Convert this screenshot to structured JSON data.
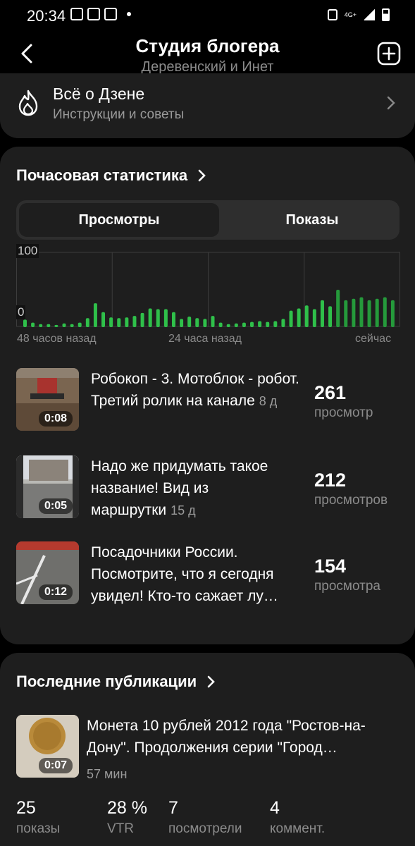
{
  "status_bar": {
    "time": "20:34",
    "network": "4G+"
  },
  "header": {
    "title": "Студия блогера",
    "subtitle": "Деревенский и Инет"
  },
  "zen_card": {
    "title": "Всё о Дзене",
    "subtitle": "Инструкции и советы"
  },
  "hourly_stats": {
    "title": "Почасовая статистика",
    "tabs": [
      {
        "label": "Просмотры",
        "active": true
      },
      {
        "label": "Показы",
        "active": false
      }
    ],
    "x_labels": [
      "48 часов назад",
      "24 часа назад",
      "сейчас"
    ]
  },
  "chart_data": {
    "type": "bar",
    "ylim": [
      0,
      100
    ],
    "y_tick_labels": [
      "100",
      "0"
    ],
    "xlabels": [
      "48 часов назад",
      "24 часа назад",
      "сейчас"
    ],
    "grid": true,
    "colors": {
      "bar": "#2fc04a",
      "bar_recent": "#259a3b"
    },
    "values": [
      10,
      6,
      4,
      4,
      3,
      5,
      4,
      6,
      12,
      32,
      20,
      13,
      12,
      13,
      15,
      19,
      25,
      24,
      24,
      20,
      11,
      14,
      12,
      11,
      15,
      6,
      4,
      5,
      6,
      7,
      8,
      7,
      8,
      11,
      22,
      25,
      29,
      24,
      36,
      28,
      50,
      36,
      38,
      40,
      36,
      38,
      40,
      36
    ],
    "recent_from_index": 40
  },
  "top_videos": [
    {
      "title": "Робокоп - 3. Мотоблок - робот. Третий ролик на канале",
      "age": "8 д",
      "duration": "0:08",
      "count": "261",
      "unit": "просмотр"
    },
    {
      "title": "Надо же придумать такое название! Вид из маршрутки",
      "age": "15 д",
      "duration": "0:05",
      "count": "212",
      "unit": "просмотров"
    },
    {
      "title": "Посадочники России. Посмотрите, что я сегодня увидел! Кто-то сажает лу…",
      "age": "",
      "duration": "0:12",
      "count": "154",
      "unit": "просмотра"
    }
  ],
  "recent": {
    "title": "Последние публикации",
    "item": {
      "title": "Монета 10 рублей 2012 года \"Ростов-на-Дону\". Продолжения серии \"Город…",
      "time": "57 мин",
      "duration": "0:07"
    },
    "metrics": [
      {
        "value": "25",
        "label": "показы"
      },
      {
        "value": "28 %",
        "label": "VTR"
      },
      {
        "value": "7",
        "label": "посмотрели"
      },
      {
        "value": "4",
        "label": "коммент."
      }
    ]
  }
}
